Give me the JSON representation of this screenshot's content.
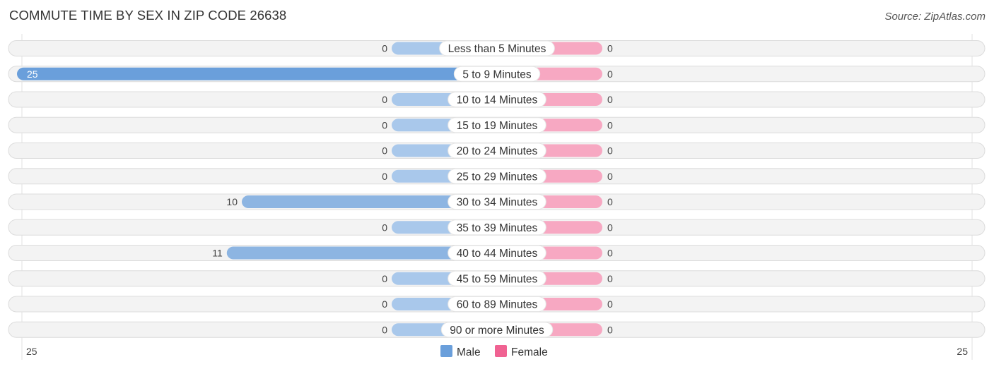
{
  "header": {
    "title": "COMMUTE TIME BY SEX IN ZIP CODE 26638",
    "source": "Source: ZipAtlas.com"
  },
  "colors": {
    "male": "#6a9fdb",
    "male_light": "#a9c8eb",
    "female": "#f06292",
    "female_light": "#f7a8c2",
    "row_bg": "#f3f3f3"
  },
  "chart_data": {
    "type": "bar",
    "orientation": "horizontal-diverging",
    "title": "COMMUTE TIME BY SEX IN ZIP CODE 26638",
    "categories": [
      "Less than 5 Minutes",
      "5 to 9 Minutes",
      "10 to 14 Minutes",
      "15 to 19 Minutes",
      "20 to 24 Minutes",
      "25 to 29 Minutes",
      "30 to 34 Minutes",
      "35 to 39 Minutes",
      "40 to 44 Minutes",
      "45 to 59 Minutes",
      "60 to 89 Minutes",
      "90 or more Minutes"
    ],
    "series": [
      {
        "name": "Male",
        "values": [
          0,
          25,
          0,
          0,
          0,
          0,
          10,
          0,
          11,
          0,
          0,
          0
        ]
      },
      {
        "name": "Female",
        "values": [
          0,
          0,
          0,
          0,
          0,
          0,
          0,
          0,
          0,
          0,
          0,
          0
        ]
      }
    ],
    "axis": {
      "left_max_label": "25",
      "right_max_label": "25",
      "range": [
        0,
        25
      ]
    },
    "legend": {
      "position": "bottom-center",
      "entries": [
        "Male",
        "Female"
      ]
    }
  }
}
